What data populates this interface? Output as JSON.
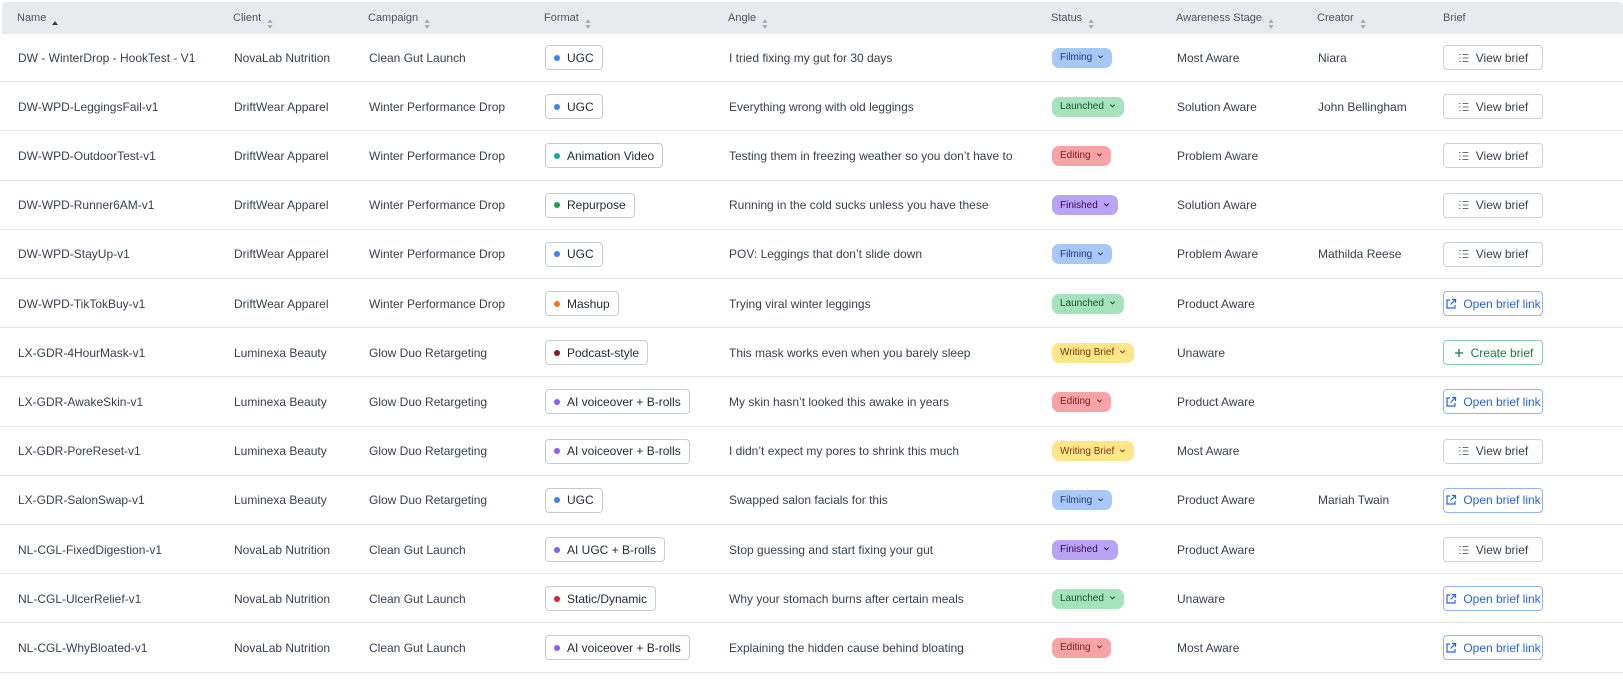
{
  "columns": [
    {
      "key": "name",
      "label": "Name",
      "sort": "asc"
    },
    {
      "key": "client",
      "label": "Client",
      "sort": "none"
    },
    {
      "key": "campaign",
      "label": "Campaign",
      "sort": "none"
    },
    {
      "key": "format",
      "label": "Format",
      "sort": "none"
    },
    {
      "key": "angle",
      "label": "Angle",
      "sort": "none"
    },
    {
      "key": "status",
      "label": "Status",
      "sort": "none"
    },
    {
      "key": "awareness",
      "label": "Awareness Stage",
      "sort": "none"
    },
    {
      "key": "creator",
      "label": "Creator",
      "sort": "none"
    },
    {
      "key": "brief",
      "label": "Brief",
      "sort": null
    }
  ],
  "format_colors": {
    "UGC": "#3b82f6",
    "Animation Video": "#0ea5a4",
    "Repurpose": "#16a34a",
    "Mashup": "#f97316",
    "Podcast-style": "#7f1d1d",
    "AI voiceover + B-rolls": "#8b5cf6",
    "AI UGC + B-rolls": "#8b5cf6",
    "Static/Dynamic": "#dc2626"
  },
  "status_classes": {
    "Filming": "s-filming",
    "Launched": "s-launched",
    "Editing": "s-editing",
    "Finished": "s-finished",
    "Writing Brief": "s-writing"
  },
  "brief_actions": {
    "view": {
      "label": "View brief",
      "icon": "list-icon"
    },
    "link": {
      "label": "Open brief link",
      "icon": "external-link-icon"
    },
    "create": {
      "label": "Create brief",
      "icon": "plus-icon"
    }
  },
  "rows": [
    {
      "name": "DW - WinterDrop - HookTest - V1",
      "client": "NovaLab Nutrition",
      "campaign": "Clean Gut Launch",
      "format": "UGC",
      "angle": "I tried fixing my gut for 30 days",
      "status": "Filming",
      "awareness": "Most Aware",
      "creator": "Niara",
      "brief": "view"
    },
    {
      "name": "DW-WPD-LeggingsFail-v1",
      "client": "DriftWear Apparel",
      "campaign": "Winter Performance Drop",
      "format": "UGC",
      "angle": "Everything wrong with old leggings",
      "status": "Launched",
      "awareness": "Solution Aware",
      "creator": "John Bellingham",
      "brief": "view"
    },
    {
      "name": "DW-WPD-OutdoorTest-v1",
      "client": "DriftWear Apparel",
      "campaign": "Winter Performance Drop",
      "format": "Animation Video",
      "angle": "Testing them in freezing weather so you don’t have to",
      "status": "Editing",
      "awareness": "Problem Aware",
      "creator": "",
      "brief": "view"
    },
    {
      "name": "DW-WPD-Runner6AM-v1",
      "client": "DriftWear Apparel",
      "campaign": "Winter Performance Drop",
      "format": "Repurpose",
      "angle": "Running in the cold sucks unless you have these",
      "status": "Finished",
      "awareness": "Solution Aware",
      "creator": "",
      "brief": "view"
    },
    {
      "name": "DW-WPD-StayUp-v1",
      "client": "DriftWear Apparel",
      "campaign": "Winter Performance Drop",
      "format": "UGC",
      "angle": "POV: Leggings that don’t slide down",
      "status": "Filming",
      "awareness": "Problem Aware",
      "creator": "Mathilda Reese",
      "brief": "view"
    },
    {
      "name": "DW-WPD-TikTokBuy-v1",
      "client": "DriftWear Apparel",
      "campaign": "Winter Performance Drop",
      "format": "Mashup",
      "angle": "Trying viral winter leggings",
      "status": "Launched",
      "awareness": "Product Aware",
      "creator": "",
      "brief": "link"
    },
    {
      "name": "LX-GDR-4HourMask-v1",
      "client": "Luminexa Beauty",
      "campaign": "Glow Duo Retargeting",
      "format": "Podcast-style",
      "angle": "This mask works even when you barely sleep",
      "status": "Writing Brief",
      "awareness": "Unaware",
      "creator": "",
      "brief": "create"
    },
    {
      "name": "LX-GDR-AwakeSkin-v1",
      "client": "Luminexa Beauty",
      "campaign": "Glow Duo Retargeting",
      "format": "AI voiceover + B-rolls",
      "angle": "My skin hasn’t looked this awake in years",
      "status": "Editing",
      "awareness": "Product Aware",
      "creator": "",
      "brief": "link"
    },
    {
      "name": "LX-GDR-PoreReset-v1",
      "client": "Luminexa Beauty",
      "campaign": "Glow Duo Retargeting",
      "format": "AI voiceover + B-rolls",
      "angle": "I didn’t expect my pores to shrink this much",
      "status": "Writing Brief",
      "awareness": "Most Aware",
      "creator": "",
      "brief": "view"
    },
    {
      "name": "LX-GDR-SalonSwap-v1",
      "client": "Luminexa Beauty",
      "campaign": "Glow Duo Retargeting",
      "format": "UGC",
      "angle": "Swapped salon facials for this",
      "status": "Filming",
      "awareness": "Product Aware",
      "creator": "Mariah Twain",
      "brief": "link"
    },
    {
      "name": "NL-CGL-FixedDigestion-v1",
      "client": "NovaLab Nutrition",
      "campaign": "Clean Gut Launch",
      "format": "AI UGC + B-rolls",
      "angle": "Stop guessing and start fixing your gut",
      "status": "Finished",
      "awareness": "Product Aware",
      "creator": "",
      "brief": "view"
    },
    {
      "name": "NL-CGL-UlcerRelief-v1",
      "client": "NovaLab Nutrition",
      "campaign": "Clean Gut Launch",
      "format": "Static/Dynamic",
      "angle": "Why your stomach burns after certain meals",
      "status": "Launched",
      "awareness": "Unaware",
      "creator": "",
      "brief": "link"
    },
    {
      "name": "NL-CGL-WhyBloated-v1",
      "client": "NovaLab Nutrition",
      "campaign": "Clean Gut Launch",
      "format": "AI voiceover + B-rolls",
      "angle": "Explaining the hidden cause behind bloating",
      "status": "Editing",
      "awareness": "Most Aware",
      "creator": "",
      "brief": "link"
    }
  ]
}
